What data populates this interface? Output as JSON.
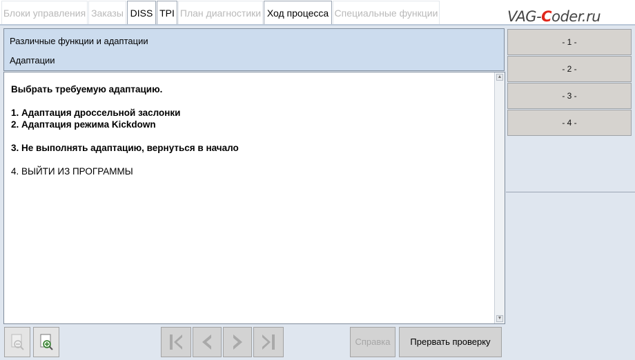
{
  "tabs": [
    {
      "label": "Блоки управления",
      "active": false
    },
    {
      "label": "Заказы",
      "active": false
    },
    {
      "label": "DISS",
      "active": true
    },
    {
      "label": "TPI",
      "active": true
    },
    {
      "label": "План диагностики",
      "active": false
    },
    {
      "label": "Ход процесса",
      "active": true
    },
    {
      "label": "Специальные функции",
      "active": false
    }
  ],
  "watermark": {
    "prefix": "VAG-",
    "accent": "C",
    "suffix": "oder.ru"
  },
  "header": {
    "title": "Различные функции и адаптации",
    "subtitle": "Адаптации"
  },
  "content": {
    "lines": [
      {
        "text": "Выбрать требуемую адаптацию.",
        "bold": true
      },
      {
        "text": "",
        "bold": false
      },
      {
        "text": "1. Адаптация дроссельной заслонки",
        "bold": true
      },
      {
        "text": "2. Адаптация режима Kickdown",
        "bold": true
      },
      {
        "text": "",
        "bold": false
      },
      {
        "text": "3. Не выполнять адаптацию, вернуться в начало",
        "bold": true
      },
      {
        "text": "",
        "bold": false
      },
      {
        "text": "4. ВЫЙТИ ИЗ ПРОГРАММЫ",
        "bold": false
      }
    ]
  },
  "side_buttons": [
    "- 1 -",
    "- 2 -",
    "- 3 -",
    "- 4 -"
  ],
  "toolbar": {
    "help_label": "Справка",
    "abort_label": "Прервать проверку"
  },
  "icons": {
    "zoom_out": "zoom-out-icon",
    "zoom_in": "zoom-in-icon",
    "first": "skip-first-icon",
    "prev": "chevron-left-icon",
    "next": "chevron-right-icon",
    "last": "skip-last-icon"
  },
  "colors": {
    "header_bg": "#ccdcee",
    "page_bg": "#dfe6ef",
    "watermark_accent": "#e0261b"
  }
}
